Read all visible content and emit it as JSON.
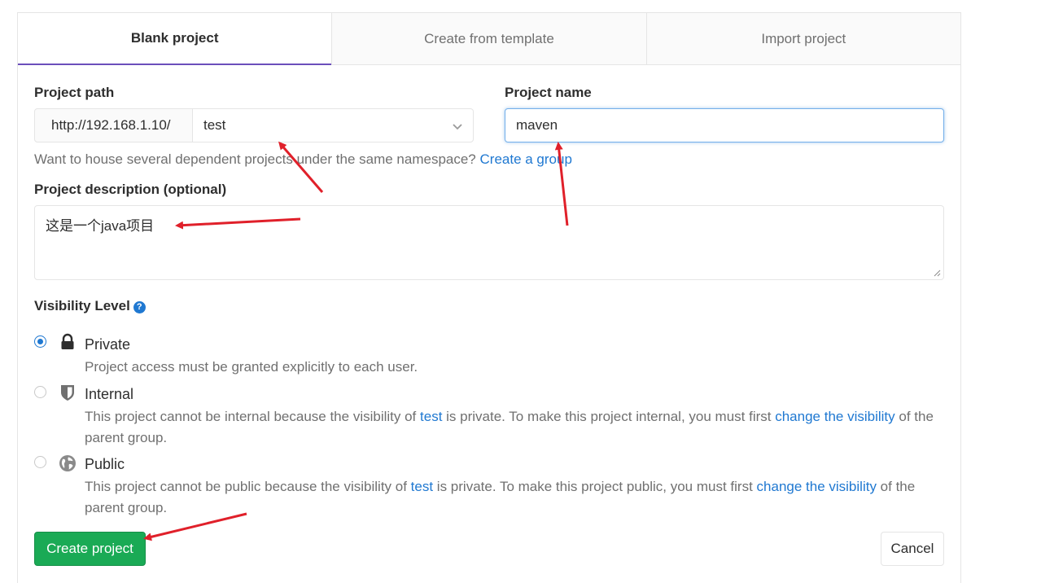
{
  "tabs": [
    {
      "label": "Blank project",
      "active": true
    },
    {
      "label": "Create from template",
      "active": false
    },
    {
      "label": "Import project",
      "active": false
    }
  ],
  "project_path": {
    "label": "Project path",
    "prefix": "http://192.168.1.10/",
    "namespace_value": "test"
  },
  "project_name": {
    "label": "Project name",
    "value": "maven"
  },
  "help": {
    "text": "Want to house several dependent projects under the same namespace? ",
    "link": "Create a group"
  },
  "description": {
    "label": "Project description (optional)",
    "value": "这是一个java项目"
  },
  "visibility": {
    "label": "Visibility Level",
    "info_icon": "question-circle-icon",
    "options": [
      {
        "title": "Private",
        "icon": "lock-icon",
        "selected": true,
        "desc": "Project access must be granted explicitly to each user."
      },
      {
        "title": "Internal",
        "icon": "shield-icon",
        "selected": false,
        "desc_a": "This project cannot be internal because the visibility of ",
        "desc_link1": "test",
        "desc_b": " is private. To make this project internal, you must first ",
        "desc_link2": "change the visibility",
        "desc_c": " of the parent group."
      },
      {
        "title": "Public",
        "icon": "globe-icon",
        "selected": false,
        "desc_a": "This project cannot be public because the visibility of ",
        "desc_link1": "test",
        "desc_b": " is private. To make this project public, you must first ",
        "desc_link2": "change the visibility",
        "desc_c": " of the parent group."
      }
    ]
  },
  "buttons": {
    "create": "Create project",
    "cancel": "Cancel"
  },
  "colors": {
    "accent": "#1f78d1",
    "create_button": "#1aaa55",
    "annotation_arrow": "#e0202a",
    "active_tab_underline": "#6b4fbb"
  }
}
